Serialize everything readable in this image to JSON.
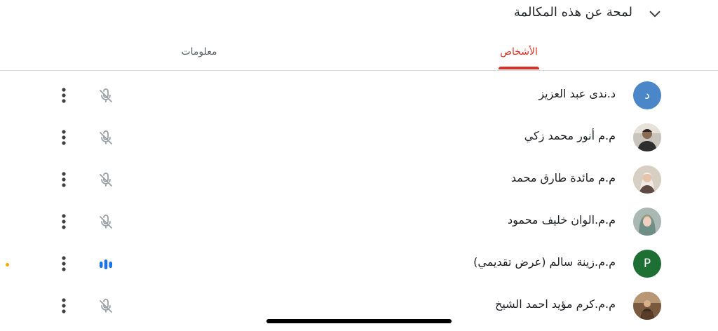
{
  "header": {
    "title": "لمحة عن هذه المكالمة"
  },
  "tabs": [
    {
      "label": "الأشخاص",
      "active": true
    },
    {
      "label": "معلومات",
      "active": false
    }
  ],
  "colors": {
    "accent": "#d93025",
    "avatar_blue": "#4a86c8",
    "avatar_green": "#1e6f33",
    "speaking_blue": "#1a73e8",
    "muted_gray": "#9aa0a6",
    "indicator_dot": "#f9ab00"
  },
  "participants": [
    {
      "name": "د.ندى عبد العزيز",
      "avatar_letter": "د",
      "avatar_type": "letter",
      "avatar_color": "#4a86c8",
      "mic": "muted-mic-icon"
    },
    {
      "name": "م.م أنور محمد زكي",
      "avatar_letter": "",
      "avatar_type": "photo",
      "mic": "muted-mic-icon"
    },
    {
      "name": "م.م مائدة طارق محمد",
      "avatar_letter": "",
      "avatar_type": "photo",
      "mic": "muted-mic-icon"
    },
    {
      "name": "م.م.الوان خليف محمود",
      "avatar_letter": "",
      "avatar_type": "photo",
      "mic": "muted-mic-icon"
    },
    {
      "name": "م.م.زينة سالم (عرض تقديمي)",
      "avatar_letter": "P",
      "avatar_type": "letter",
      "avatar_color": "#1e6f33",
      "mic": "speaking-audio-icon"
    },
    {
      "name": "م.م.كرم مؤيد احمد الشيخ",
      "avatar_letter": "",
      "avatar_type": "photo",
      "mic": "muted-mic-icon"
    }
  ]
}
